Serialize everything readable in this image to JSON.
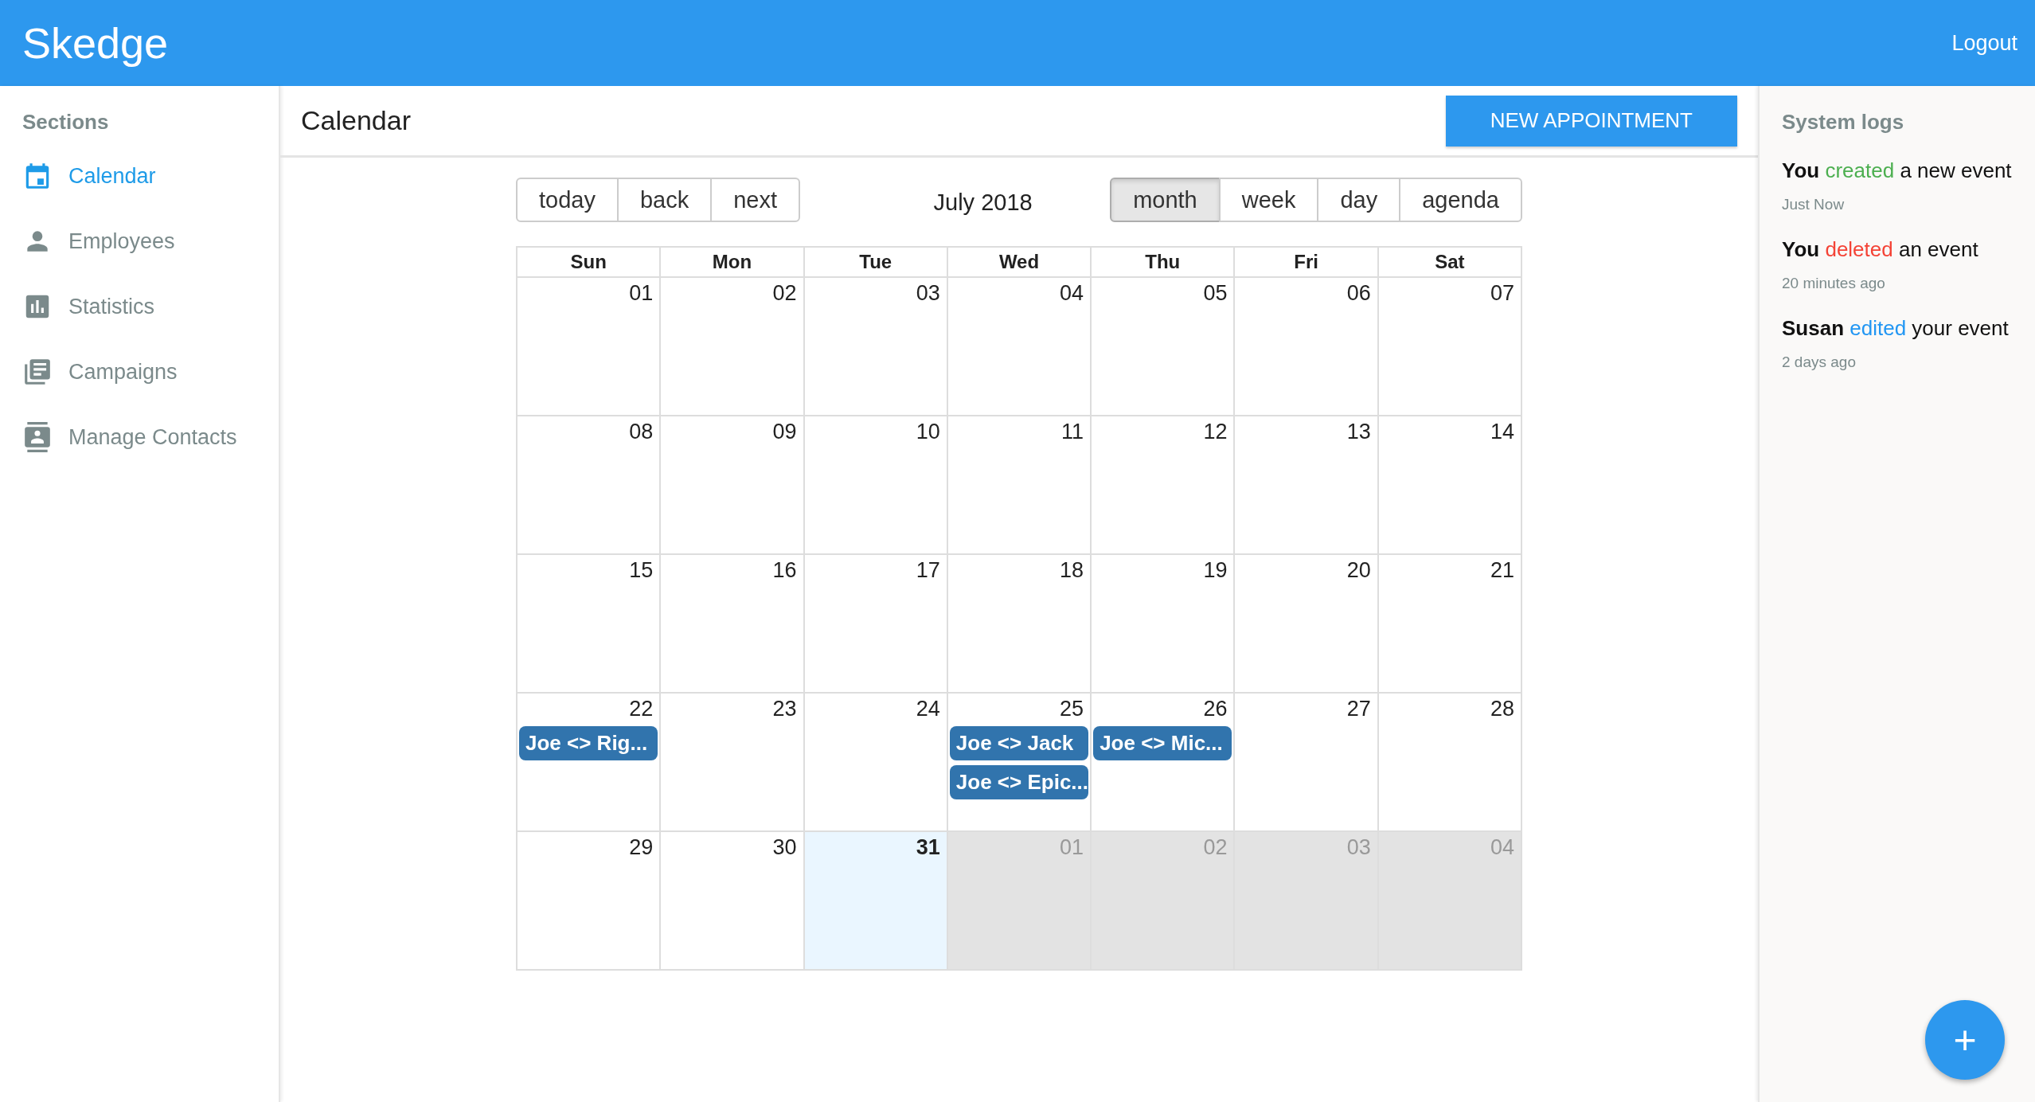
{
  "app": {
    "title": "Skedge",
    "logout": "Logout"
  },
  "sidebar": {
    "heading": "Sections",
    "items": [
      {
        "label": "Calendar",
        "selected": true
      },
      {
        "label": "Employees",
        "selected": false
      },
      {
        "label": "Statistics",
        "selected": false
      },
      {
        "label": "Campaigns",
        "selected": false
      },
      {
        "label": "Manage Contacts",
        "selected": false
      }
    ]
  },
  "page": {
    "title": "Calendar",
    "action": "NEW APPOINTMENT"
  },
  "calendar": {
    "nav": [
      {
        "label": "today"
      },
      {
        "label": "back"
      },
      {
        "label": "next"
      }
    ],
    "label": "July 2018",
    "views": [
      {
        "label": "month",
        "selected": true
      },
      {
        "label": "week",
        "selected": false
      },
      {
        "label": "day",
        "selected": false
      },
      {
        "label": "agenda",
        "selected": false
      }
    ],
    "weekdays": [
      "Sun",
      "Mon",
      "Tue",
      "Wed",
      "Thu",
      "Fri",
      "Sat"
    ],
    "weeks": [
      [
        {
          "date": "01",
          "today": false,
          "off_range": false
        },
        {
          "date": "02",
          "today": false,
          "off_range": false
        },
        {
          "date": "03",
          "today": false,
          "off_range": false
        },
        {
          "date": "04",
          "today": false,
          "off_range": false
        },
        {
          "date": "05",
          "today": false,
          "off_range": false
        },
        {
          "date": "06",
          "today": false,
          "off_range": false
        },
        {
          "date": "07",
          "today": false,
          "off_range": false
        }
      ],
      [
        {
          "date": "08",
          "today": false,
          "off_range": false
        },
        {
          "date": "09",
          "today": false,
          "off_range": false
        },
        {
          "date": "10",
          "today": false,
          "off_range": false
        },
        {
          "date": "11",
          "today": false,
          "off_range": false
        },
        {
          "date": "12",
          "today": false,
          "off_range": false
        },
        {
          "date": "13",
          "today": false,
          "off_range": false
        },
        {
          "date": "14",
          "today": false,
          "off_range": false
        }
      ],
      [
        {
          "date": "15",
          "today": false,
          "off_range": false
        },
        {
          "date": "16",
          "today": false,
          "off_range": false
        },
        {
          "date": "17",
          "today": false,
          "off_range": false
        },
        {
          "date": "18",
          "today": false,
          "off_range": false
        },
        {
          "date": "19",
          "today": false,
          "off_range": false
        },
        {
          "date": "20",
          "today": false,
          "off_range": false
        },
        {
          "date": "21",
          "today": false,
          "off_range": false
        }
      ],
      [
        {
          "date": "22",
          "today": false,
          "off_range": false,
          "events": [
            "Joe <> Rig..."
          ]
        },
        {
          "date": "23",
          "today": false,
          "off_range": false
        },
        {
          "date": "24",
          "today": false,
          "off_range": false
        },
        {
          "date": "25",
          "today": false,
          "off_range": false,
          "events": [
            "Joe <> Jack",
            "Joe <> Epic..."
          ]
        },
        {
          "date": "26",
          "today": false,
          "off_range": false,
          "events": [
            "Joe <> Mic..."
          ]
        },
        {
          "date": "27",
          "today": false,
          "off_range": false
        },
        {
          "date": "28",
          "today": false,
          "off_range": false
        }
      ],
      [
        {
          "date": "29",
          "today": false,
          "off_range": false
        },
        {
          "date": "30",
          "today": false,
          "off_range": false
        },
        {
          "date": "31",
          "today": true,
          "off_range": false
        },
        {
          "date": "01",
          "today": false,
          "off_range": true
        },
        {
          "date": "02",
          "today": false,
          "off_range": true
        },
        {
          "date": "03",
          "today": false,
          "off_range": true
        },
        {
          "date": "04",
          "today": false,
          "off_range": true
        }
      ]
    ]
  },
  "system_logs": {
    "heading": "System logs",
    "entries": [
      {
        "actor": "You",
        "verb": "created",
        "color": "#4caf50",
        "rest": "a new event",
        "time": "Just Now"
      },
      {
        "actor": "You",
        "verb": "deleted",
        "color": "#f44336",
        "rest": "an event",
        "time": "20 minutes ago"
      },
      {
        "actor": "Susan",
        "verb": "edited",
        "color": "#2196f3",
        "rest": "your event",
        "time": "2 days ago"
      }
    ]
  },
  "fab": {
    "label": "+"
  }
}
